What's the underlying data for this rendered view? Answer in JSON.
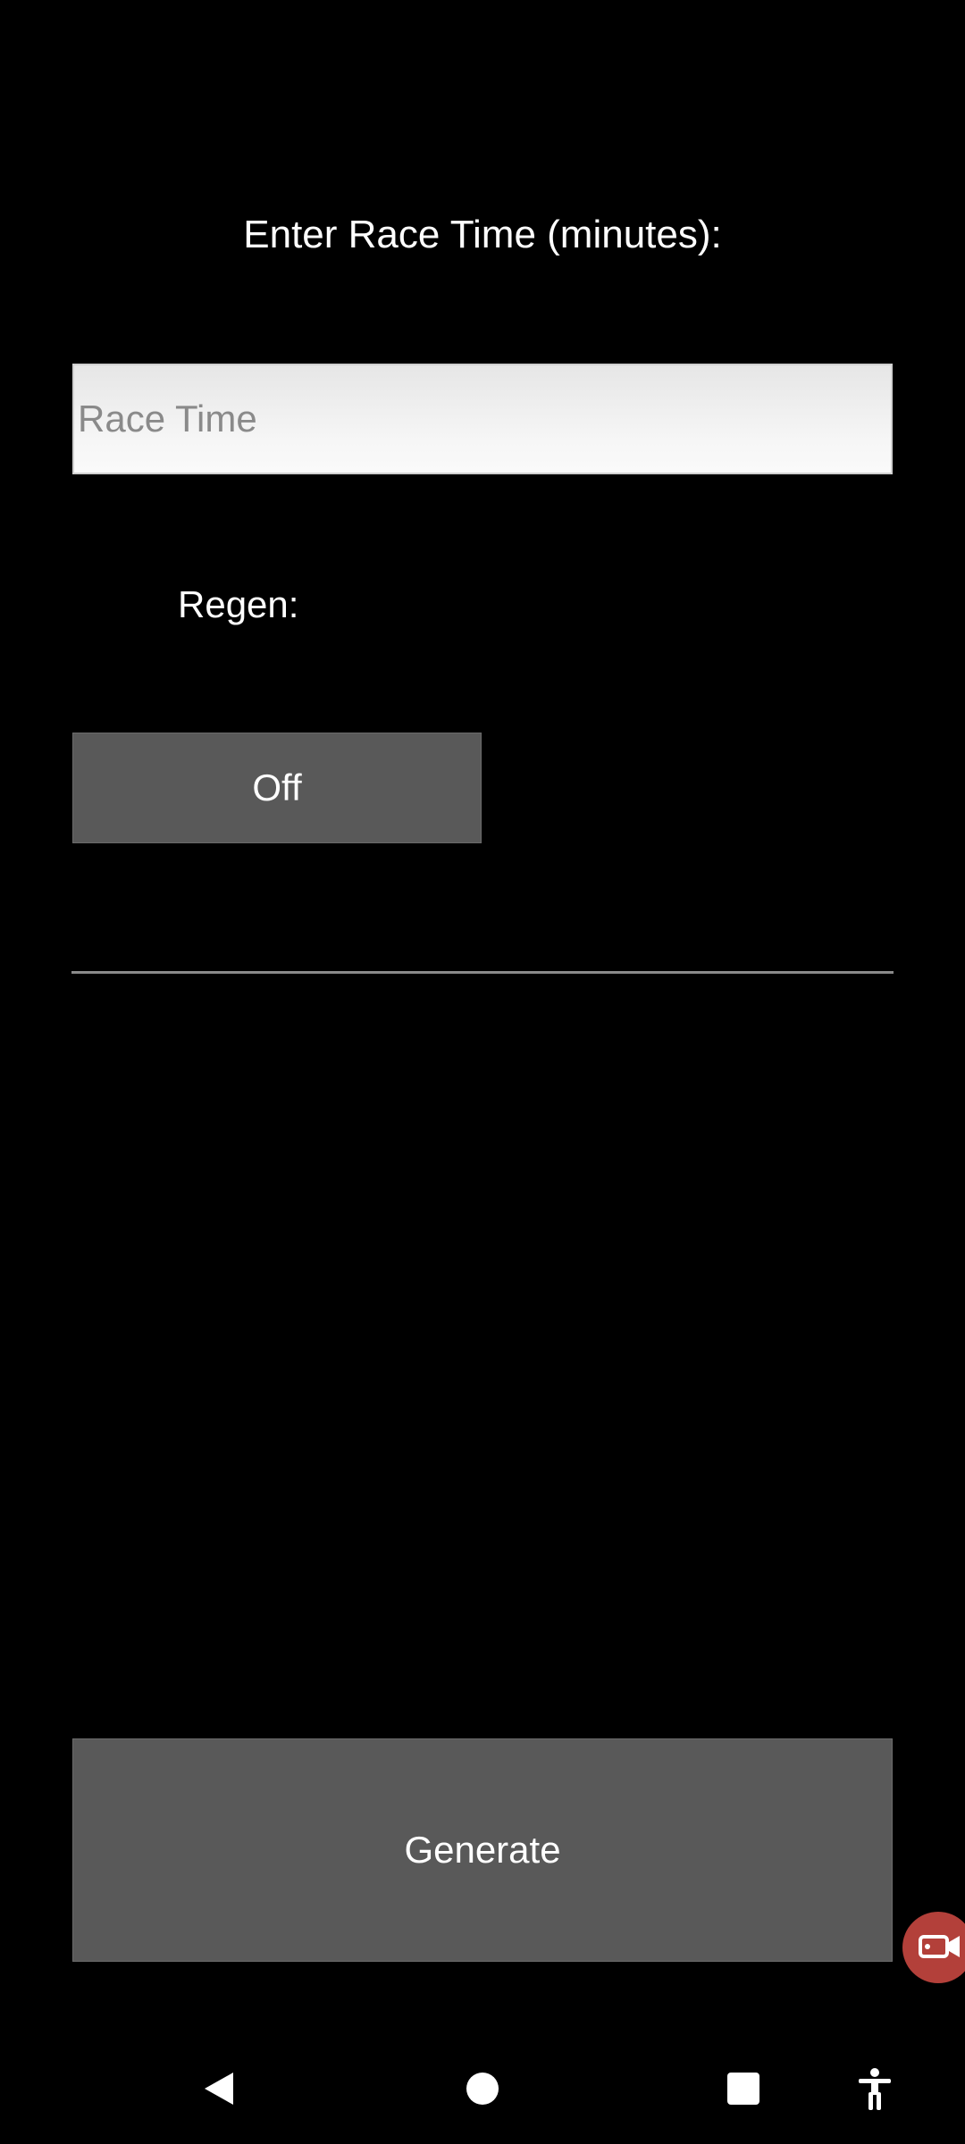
{
  "form": {
    "title": "Enter Race Time (minutes):",
    "race_time_value": "",
    "race_time_placeholder": "Race Time",
    "regen_label": "Regen:",
    "regen_toggle_label": "Off",
    "generate_label": "Generate"
  },
  "colors": {
    "background": "#000000",
    "button": "#595959",
    "input_background": "#f2f2f2",
    "divider": "#8a8a8a",
    "fab": "#b3403a"
  },
  "icons": {
    "fab": "screen-record-icon",
    "nav_back": "back-triangle-icon",
    "nav_home": "home-circle-icon",
    "nav_recents": "recents-square-icon",
    "nav_accessibility": "accessibility-icon"
  }
}
